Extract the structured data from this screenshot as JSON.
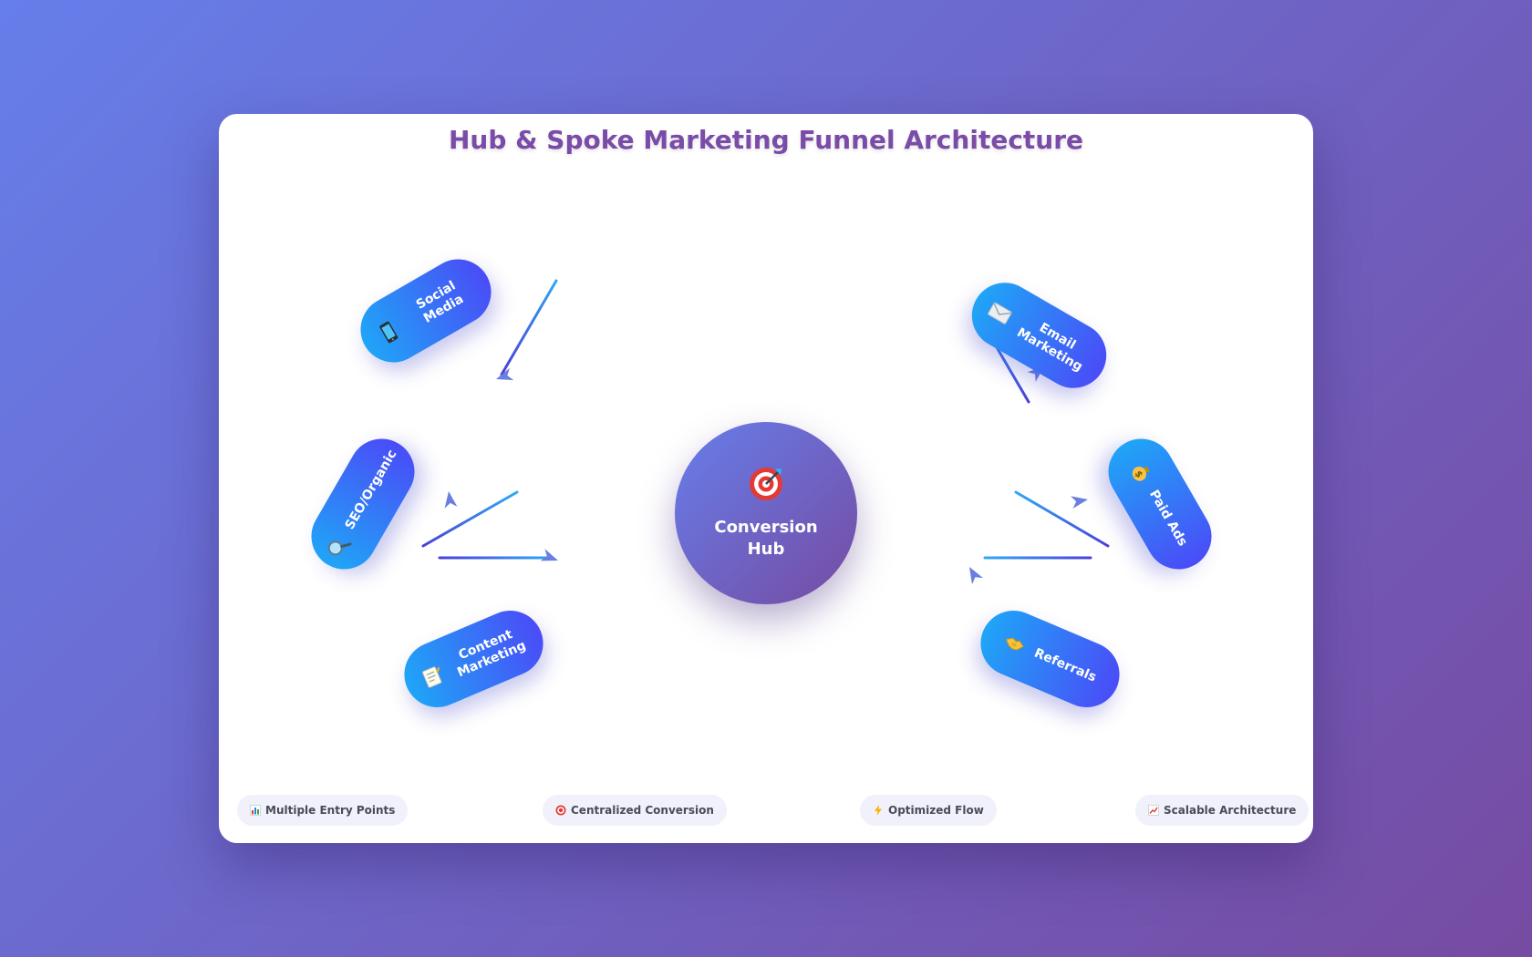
{
  "title": "Hub & Spoke Marketing Funnel Architecture",
  "hub": {
    "label": "Conversion Hub",
    "icon": "target-icon"
  },
  "spokes": [
    {
      "label": "Social Media",
      "icon": "mobile-phone-icon"
    },
    {
      "label": "SEO/Organic",
      "icon": "magnifier-icon"
    },
    {
      "label": "Content Marketing",
      "icon": "memo-icon"
    },
    {
      "label": "Email Marketing",
      "icon": "envelope-icon"
    },
    {
      "label": "Paid Ads",
      "icon": "money-bag-icon"
    },
    {
      "label": "Referrals",
      "icon": "handshake-icon"
    }
  ],
  "features": [
    {
      "label": "Multiple Entry Points",
      "icon": "bar-chart-icon"
    },
    {
      "label": "Centralized Conversion",
      "icon": "target-icon"
    },
    {
      "label": "Optimized Flow",
      "icon": "lightning-icon"
    },
    {
      "label": "Scalable Architecture",
      "icon": "trend-up-icon"
    }
  ],
  "colors": {
    "background_start": "#667eea",
    "background_end": "#764ba2",
    "title": "#7a4ba8",
    "spoke_start": "#1fa5f7",
    "spoke_end": "#4a4cf7",
    "arrow_head": "#6b7fe0"
  }
}
